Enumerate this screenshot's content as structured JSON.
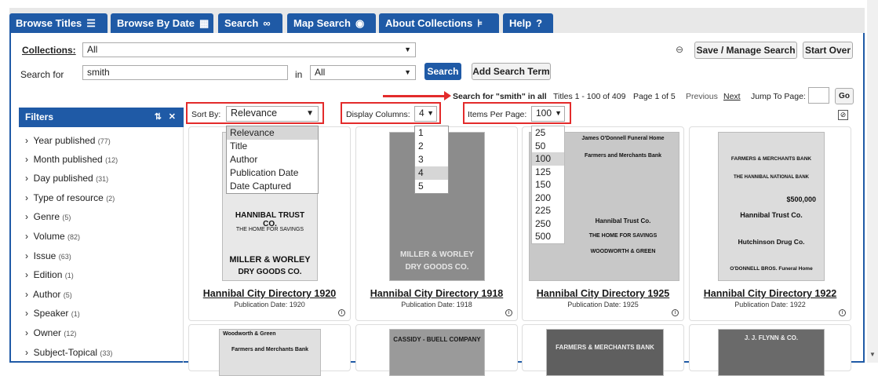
{
  "tabs": [
    {
      "label": "Browse Titles",
      "icon": "list-icon"
    },
    {
      "label": "Browse By Date",
      "icon": "calendar-icon"
    },
    {
      "label": "Search",
      "icon": "binoculars-icon"
    },
    {
      "label": "Map Search",
      "icon": "globe-icon"
    },
    {
      "label": "About Collections",
      "icon": "tree-icon"
    },
    {
      "label": "Help",
      "icon": "help-icon"
    }
  ],
  "search_form": {
    "collections_label": "Collections:",
    "collections_value": "All",
    "search_for_label": "Search for",
    "search_value": "smith",
    "in_label": "in",
    "in_value": "All",
    "search_button": "Search",
    "add_term_button": "Add Search Term",
    "save_button": "Save / Manage Search",
    "start_over_button": "Start Over"
  },
  "results_bar": {
    "search_for": "Search for \"smith\" in all",
    "titles": "Titles 1 - 100 of 409",
    "page": "Page 1 of 5",
    "previous": "Previous",
    "next": "Next",
    "jump_label": "Jump To Page:",
    "go": "Go"
  },
  "filters": {
    "title": "Filters",
    "items": [
      {
        "label": "Year published",
        "count": "(77)"
      },
      {
        "label": "Month published",
        "count": "(12)"
      },
      {
        "label": "Day published",
        "count": "(31)"
      },
      {
        "label": "Type of resource",
        "count": "(2)"
      },
      {
        "label": "Genre",
        "count": "(5)"
      },
      {
        "label": "Volume",
        "count": "(82)"
      },
      {
        "label": "Issue",
        "count": "(63)"
      },
      {
        "label": "Edition",
        "count": "(1)"
      },
      {
        "label": "Author",
        "count": "(5)"
      },
      {
        "label": "Speaker",
        "count": "(1)"
      },
      {
        "label": "Owner",
        "count": "(12)"
      },
      {
        "label": "Subject-Topical",
        "count": "(33)"
      }
    ]
  },
  "controls": {
    "sort_label": "Sort By:",
    "sort_value": "Relevance",
    "sort_options": [
      "Relevance",
      "Title",
      "Author",
      "Publication Date",
      "Date Captured"
    ],
    "columns_label": "Display Columns:",
    "columns_value": "4",
    "columns_options": [
      "1",
      "2",
      "3",
      "4",
      "5"
    ],
    "per_page_label": "Items Per Page:",
    "per_page_value": "100",
    "per_page_options": [
      "25",
      "50",
      "100",
      "125",
      "150",
      "200",
      "225",
      "250",
      "500"
    ]
  },
  "results": [
    {
      "title": "Hannibal City Directory 1920",
      "date": "Publication Date: 1920"
    },
    {
      "title": "Hannibal City Directory 1918",
      "date": "Publication Date: 1918"
    },
    {
      "title": "Hannibal City Directory 1925",
      "date": "Publication Date: 1925"
    },
    {
      "title": "Hannibal City Directory 1922",
      "date": "Publication Date: 1922"
    }
  ],
  "thumb_text": {
    "t1": [
      "HANNIBAL TRUST CO.",
      "THE HOME FOR SAVINGS",
      "MILLER & WORLEY",
      "DRY GOODS CO."
    ],
    "t2": [
      "MILLER & WORLEY",
      "DRY GOODS CO."
    ],
    "t3": [
      "James O'Donnell Funeral Home",
      "Farmers and Merchants Bank",
      "Hannibal Trust Co.",
      "THE HOME FOR SAVINGS",
      "WOODWORTH & GREEN"
    ],
    "t4": [
      "FARMERS & MERCHANTS BANK",
      "THE HANNIBAL NATIONAL BANK",
      "$500,000",
      "Hannibal Trust Co.",
      "Hutchinson Drug Co.",
      "O'DONNELL BROS. Funeral Home"
    ],
    "row2": [
      "Woodworth & Green",
      "Farmers and Merchants Bank",
      "CASSIDY - BUELL COMPANY",
      "FARMERS & MERCHANTS BANK",
      "J. J. FLYNN & CO."
    ]
  }
}
